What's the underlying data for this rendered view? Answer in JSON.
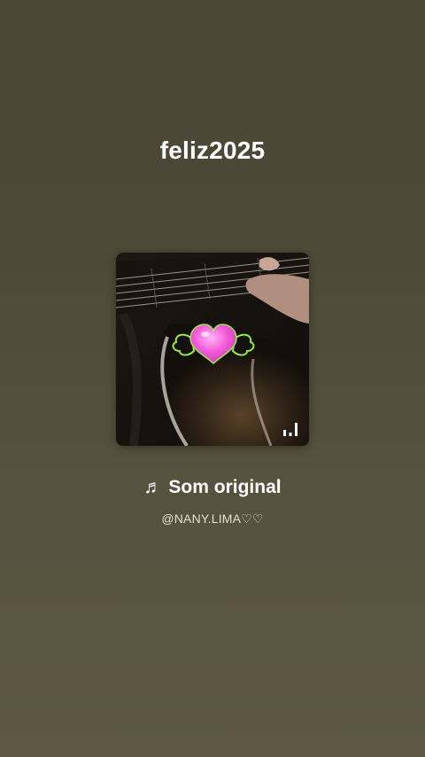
{
  "post": {
    "title": "feliz2025"
  },
  "audio": {
    "song_title": "Som original",
    "note_symbol": "♬",
    "artist": "@NANY.LIMA♡♡",
    "cover_icon": "guitar-photo-with-winged-heart-sticker",
    "playing_indicator_icon": "equalizer-bars-icon",
    "sticker_colors": {
      "heart": "#f25bd8",
      "wings_outline": "#9be84a"
    }
  }
}
